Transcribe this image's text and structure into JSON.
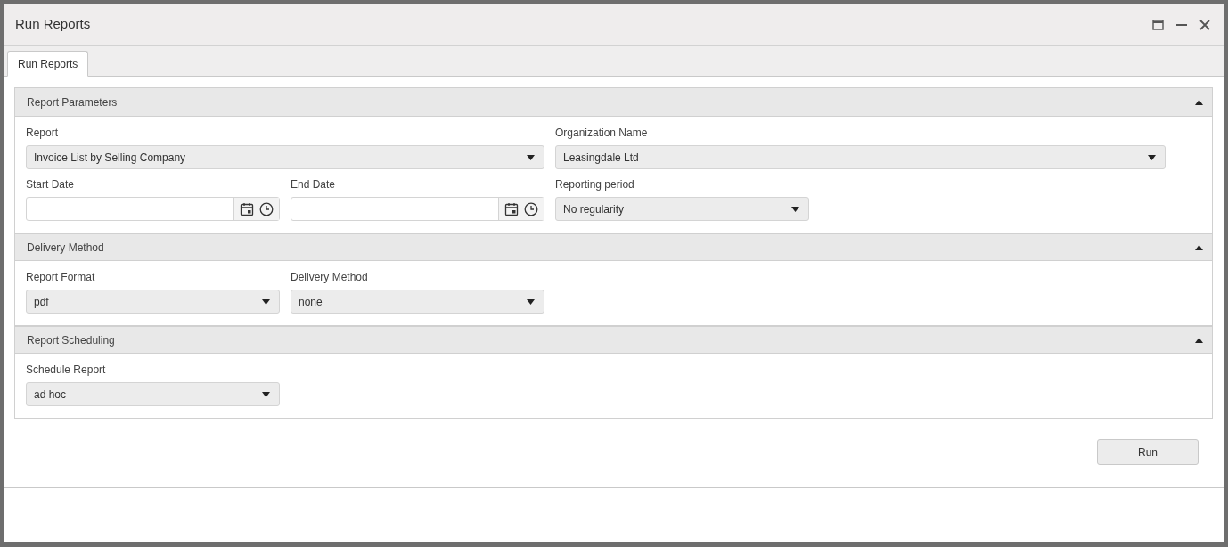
{
  "window": {
    "title": "Run Reports"
  },
  "tabs": [
    {
      "label": "Run Reports",
      "selected": true
    }
  ],
  "sections": [
    {
      "title": "Report Parameters",
      "expanded": true,
      "fields": [
        {
          "kind": "wide-select",
          "label": "Report",
          "value": "Invoice List by Selling Company"
        },
        {
          "kind": "wide-select",
          "label": "Organization Name",
          "value": "Leasingdale Ltd"
        },
        {
          "kind": "datetime",
          "label": "Start Date"
        },
        {
          "kind": "datetime",
          "label": "End Date"
        },
        {
          "kind": "select",
          "label": "Reporting period",
          "value": "No regularity"
        }
      ]
    },
    {
      "title": "Delivery Method",
      "expanded": true,
      "fields": [
        {
          "kind": "select",
          "label": "Report Format",
          "value": "pdf"
        },
        {
          "kind": "select",
          "label": "Delivery Method",
          "value": "none"
        }
      ]
    },
    {
      "title": "Report Scheduling",
      "expanded": true,
      "fields": [
        {
          "kind": "select",
          "label": "Schedule Report",
          "value": "ad hoc"
        }
      ]
    }
  ],
  "run_button": "Run"
}
